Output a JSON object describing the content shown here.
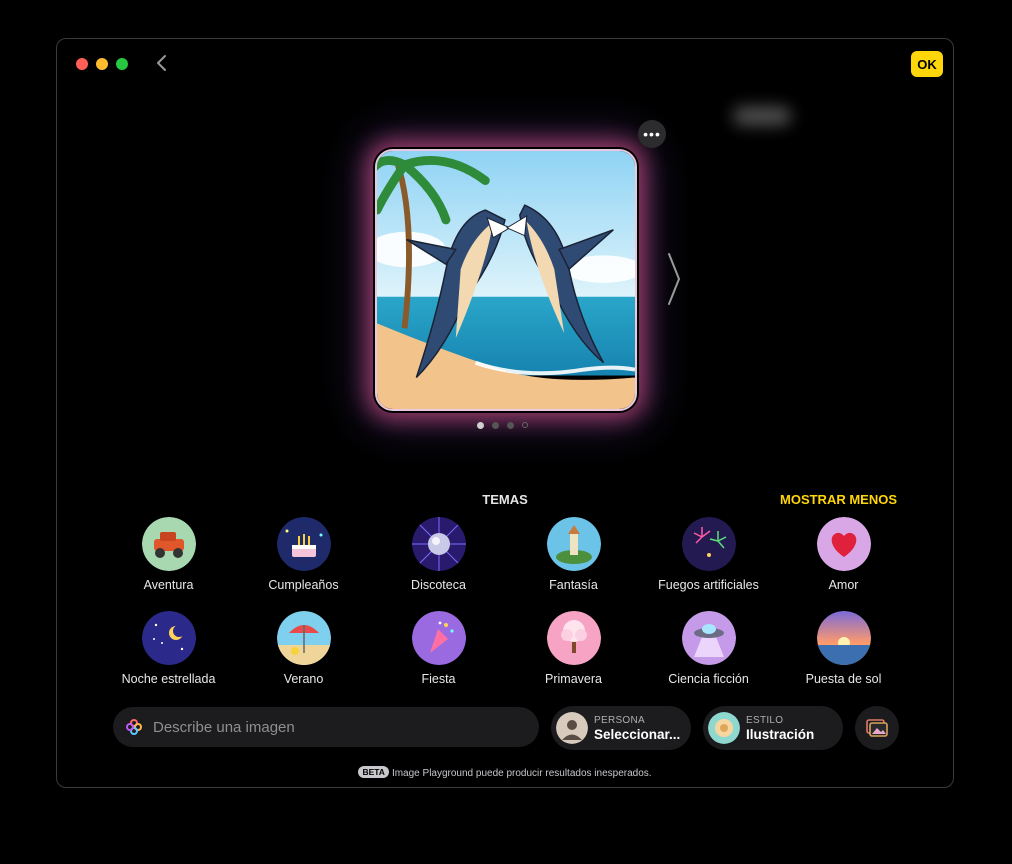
{
  "window": {
    "traffic_colors": [
      "#ff5f57",
      "#febc2e",
      "#28c840"
    ],
    "ok_label": "OK"
  },
  "preview": {
    "more_label": "•••",
    "page_count": 4,
    "active_page": 1
  },
  "themes": {
    "title": "TEMAS",
    "show_less": "MOSTRAR MENOS",
    "items": [
      {
        "label": "Aventura",
        "icon": "jeep-icon"
      },
      {
        "label": "Cumpleaños",
        "icon": "birthday-cake-icon"
      },
      {
        "label": "Discoteca",
        "icon": "disco-ball-icon"
      },
      {
        "label": "Fantasía",
        "icon": "fantasy-castle-icon"
      },
      {
        "label": "Fuegos artificiales",
        "icon": "fireworks-icon"
      },
      {
        "label": "Amor",
        "icon": "heart-icon"
      },
      {
        "label": "Noche estrellada",
        "icon": "moon-stars-icon"
      },
      {
        "label": "Verano",
        "icon": "beach-umbrella-icon"
      },
      {
        "label": "Fiesta",
        "icon": "party-popper-icon"
      },
      {
        "label": "Primavera",
        "icon": "blossom-tree-icon"
      },
      {
        "label": "Ciencia ficción",
        "icon": "ufo-icon"
      },
      {
        "label": "Puesta de sol",
        "icon": "sunset-icon"
      }
    ]
  },
  "prompt": {
    "placeholder": "Describe una imagen"
  },
  "person": {
    "label": "PERSONA",
    "value": "Seleccionar..."
  },
  "style": {
    "label": "ESTILO",
    "value": "Ilustración"
  },
  "disclaimer": {
    "badge": "BETA",
    "text": "Image Playground puede producir resultados inesperados."
  },
  "accent": "#ffd60a"
}
